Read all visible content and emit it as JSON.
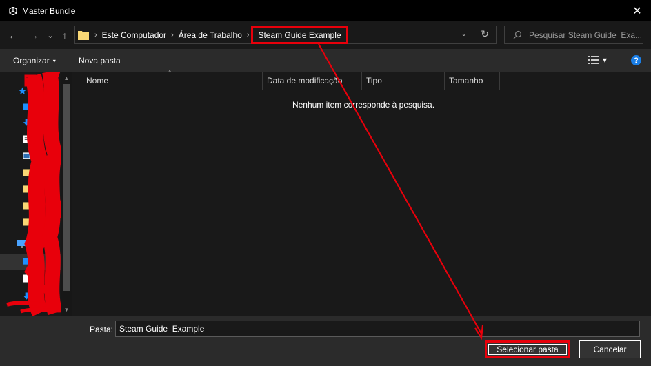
{
  "window": {
    "title": "Master Bundle",
    "close_glyph": "✕"
  },
  "nav": {
    "back_glyph": "←",
    "forward_glyph": "→",
    "recent_glyph": "⌄",
    "up_glyph": "↑",
    "breadcrumbs": [
      "Este Computador",
      "Área de Trabalho",
      "Steam Guide  Example"
    ],
    "crumb_sep": "›",
    "dropdown_glyph": "⌄",
    "refresh_glyph": "↻"
  },
  "search": {
    "placeholder": "Pesquisar Steam Guide  Exa..."
  },
  "toolbar": {
    "organize_label": "Organizar",
    "new_folder_label": "Nova pasta",
    "caret_glyph": "▾",
    "help_glyph": "?"
  },
  "columns": [
    "Nome",
    "Data de modificação",
    "Tipo",
    "Tamanho"
  ],
  "empty_message": "Nenhum item corresponde à pesquisa.",
  "footer": {
    "folder_label": "Pasta:",
    "folder_value": "Steam Guide  Example",
    "select_label": "Selecionar pasta",
    "cancel_label": "Cancelar"
  },
  "colors": {
    "accent_red": "#e8000b",
    "help_blue": "#1a7ee6",
    "folder_yellow": "#f8d775",
    "tree_blue": "#1e90ff"
  }
}
